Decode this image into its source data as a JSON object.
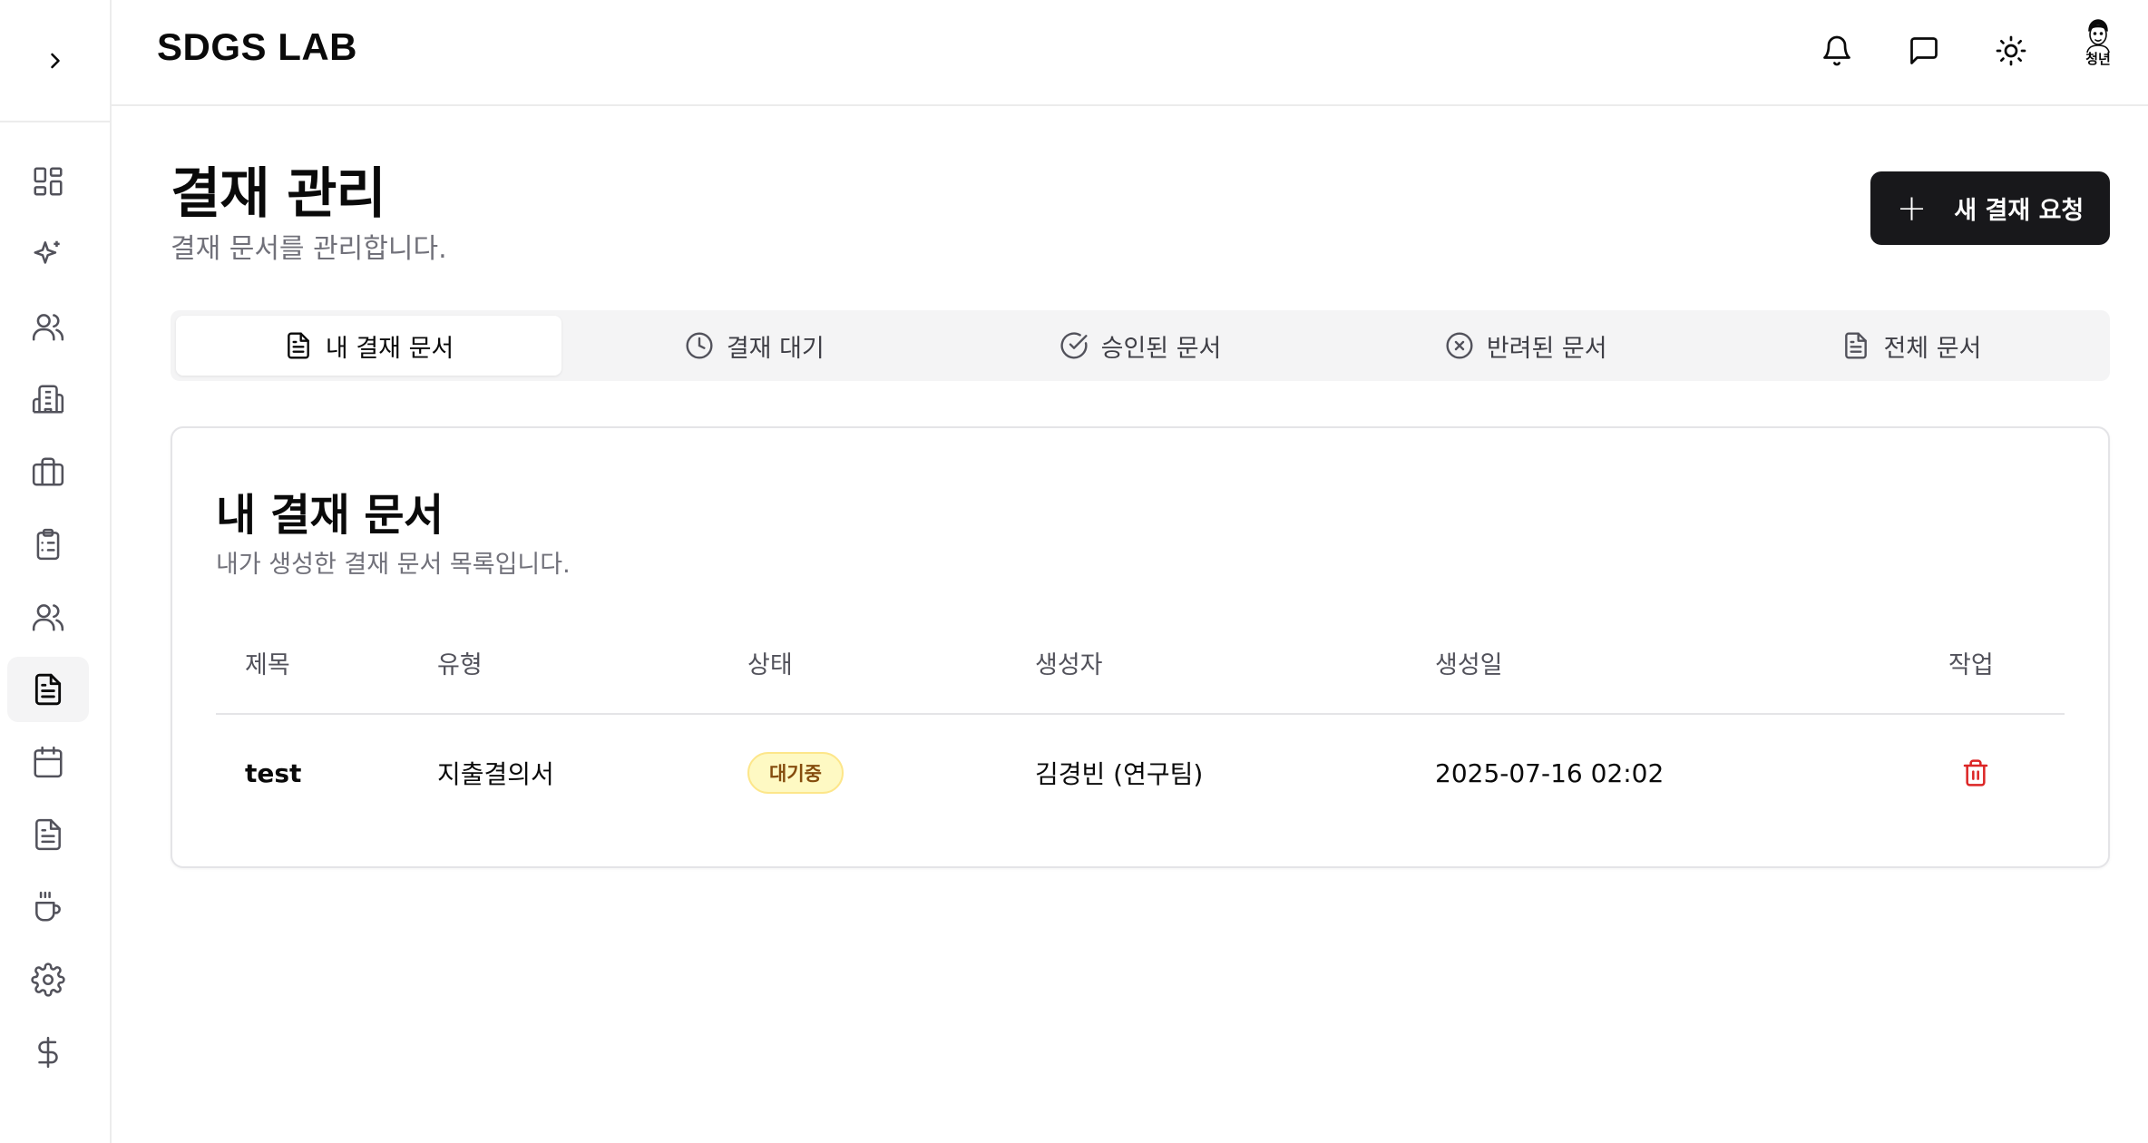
{
  "app": {
    "brand": "SDGS LAB"
  },
  "header": {
    "actions": [
      {
        "icon": "bell-icon"
      },
      {
        "icon": "message-icon"
      },
      {
        "icon": "sun-icon"
      }
    ],
    "avatar": {
      "label": "청년"
    }
  },
  "sidebar": {
    "items": [
      {
        "icon": "dashboard-icon"
      },
      {
        "icon": "sparkles-icon"
      },
      {
        "icon": "users-icon"
      },
      {
        "icon": "building-icon"
      },
      {
        "icon": "briefcase-icon"
      },
      {
        "icon": "clipboard-list-icon"
      },
      {
        "icon": "team-icon"
      },
      {
        "icon": "document-icon",
        "active": true
      },
      {
        "icon": "calendar-icon"
      },
      {
        "icon": "file-text-icon"
      },
      {
        "icon": "coffee-icon"
      },
      {
        "icon": "settings-icon"
      },
      {
        "icon": "dollar-icon"
      }
    ]
  },
  "page": {
    "title": "결재 관리",
    "subtitle": "결재 문서를 관리합니다.",
    "new_button": "새 결재 요청"
  },
  "tabs": [
    {
      "label": "내 결재 문서",
      "icon": "file-icon",
      "active": true
    },
    {
      "label": "결재 대기",
      "icon": "clock-icon"
    },
    {
      "label": "승인된 문서",
      "icon": "check-circle-icon"
    },
    {
      "label": "반려된 문서",
      "icon": "x-circle-icon"
    },
    {
      "label": "전체 문서",
      "icon": "file-icon"
    }
  ],
  "card": {
    "title": "내 결재 문서",
    "description": "내가 생성한 결재 문서 목록입니다.",
    "columns": [
      "제목",
      "유형",
      "상태",
      "생성자",
      "생성일",
      "작업"
    ],
    "rows": [
      {
        "title": "test",
        "type": "지출결의서",
        "status": "대기중",
        "creator": "김경빈 (연구팀)",
        "created": "2025-07-16 02:02",
        "action_icon": "trash-icon"
      }
    ]
  },
  "colors": {
    "accent": "#18181b",
    "badge_bg": "#fef9c3",
    "badge_text": "#854d0e",
    "delete": "#dc2626"
  }
}
